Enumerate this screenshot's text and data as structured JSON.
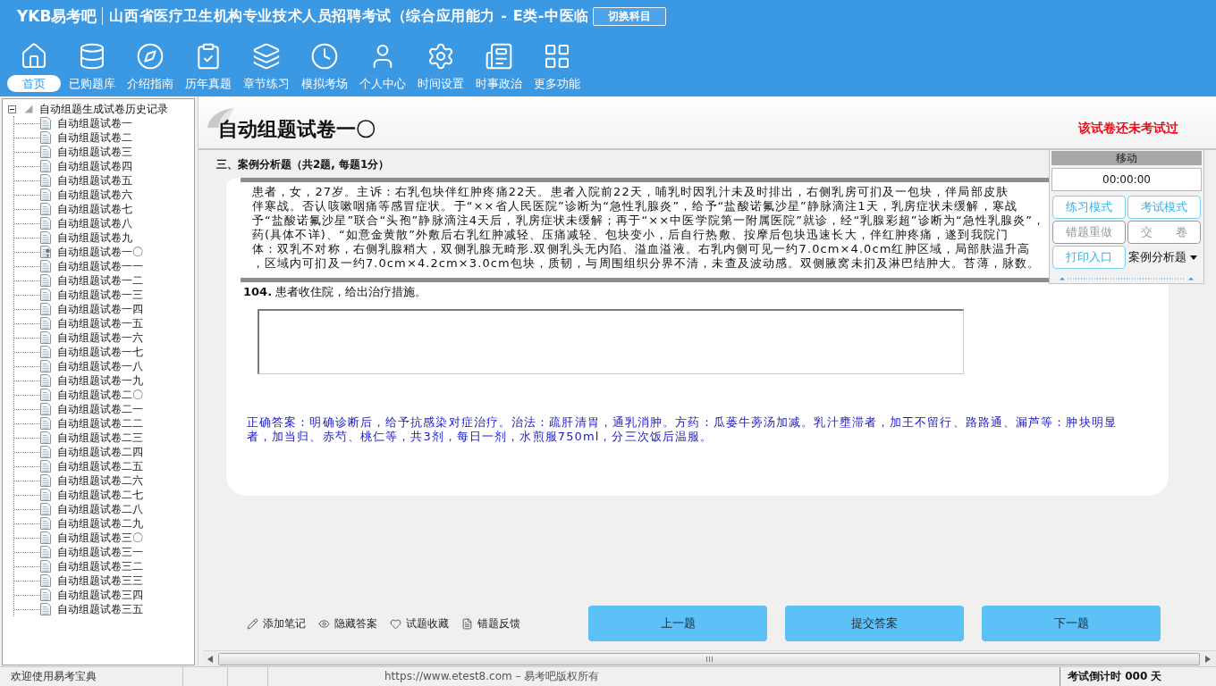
{
  "header": {
    "logo": "YKB易考吧",
    "title": "山西省医疗卫生机构专业技术人员招聘考试（综合应用能力 - E类-中医临",
    "switch_button": "切换科目"
  },
  "nav": [
    {
      "label": "首页",
      "selected": true
    },
    {
      "label": "已购题库",
      "selected": false
    },
    {
      "label": "介绍指南",
      "selected": false
    },
    {
      "label": "历年真题",
      "selected": false
    },
    {
      "label": "章节练习",
      "selected": false
    },
    {
      "label": "模拟考场",
      "selected": false
    },
    {
      "label": "个人中心",
      "selected": false
    },
    {
      "label": "时间设置",
      "selected": false
    },
    {
      "label": "时事政治",
      "selected": false
    },
    {
      "label": "更多功能",
      "selected": false
    }
  ],
  "tree": {
    "label": "自动组题生成试卷历史记录",
    "expanded": true,
    "children": [
      {
        "label": "自动组题试卷一",
        "selected": false
      },
      {
        "label": "自动组题试卷二",
        "selected": false
      },
      {
        "label": "自动组题试卷三",
        "selected": false
      },
      {
        "label": "自动组题试卷四",
        "selected": false
      },
      {
        "label": "自动组题试卷五",
        "selected": false
      },
      {
        "label": "自动组题试卷六",
        "selected": false
      },
      {
        "label": "自动组题试卷七",
        "selected": false
      },
      {
        "label": "自动组题试卷八",
        "selected": false
      },
      {
        "label": "自动组题试卷九",
        "selected": false
      },
      {
        "label": "自动组题试卷一〇",
        "selected": true
      },
      {
        "label": "自动组题试卷一一",
        "selected": false
      },
      {
        "label": "自动组题试卷一二",
        "selected": false
      },
      {
        "label": "自动组题试卷一三",
        "selected": false
      },
      {
        "label": "自动组题试卷一四",
        "selected": false
      },
      {
        "label": "自动组题试卷一五",
        "selected": false
      },
      {
        "label": "自动组题试卷一六",
        "selected": false
      },
      {
        "label": "自动组题试卷一七",
        "selected": false
      },
      {
        "label": "自动组题试卷一八",
        "selected": false
      },
      {
        "label": "自动组题试卷一九",
        "selected": false
      },
      {
        "label": "自动组题试卷二〇",
        "selected": false
      },
      {
        "label": "自动组题试卷二一",
        "selected": false
      },
      {
        "label": "自动组题试卷二二",
        "selected": false
      },
      {
        "label": "自动组题试卷二三",
        "selected": false
      },
      {
        "label": "自动组题试卷二四",
        "selected": false
      },
      {
        "label": "自动组题试卷二五",
        "selected": false
      },
      {
        "label": "自动组题试卷二六",
        "selected": false
      },
      {
        "label": "自动组题试卷二七",
        "selected": false
      },
      {
        "label": "自动组题试卷二八",
        "selected": false
      },
      {
        "label": "自动组题试卷二九",
        "selected": false
      },
      {
        "label": "自动组题试卷三〇",
        "selected": false
      },
      {
        "label": "自动组题试卷三一",
        "selected": false
      },
      {
        "label": "自动组题试卷三二",
        "selected": false
      },
      {
        "label": "自动组题试卷三三",
        "selected": false
      },
      {
        "label": "自动组题试卷三四",
        "selected": false
      },
      {
        "label": "自动组题试卷三五",
        "selected": false
      }
    ]
  },
  "paper": {
    "title": "自动组题试卷一〇",
    "status": "该试卷还未考试过"
  },
  "section": "三、案例分析题（共2题, 每题1分）",
  "case_lines": [
    "患者，女，27岁。主诉：右乳包块伴红肿疼痛22天。患者入院前22天，哺乳时因乳汁未及时排出，右侧乳房可扪及一包块，伴局部皮肤",
    "伴寒战。否认咳嗽咽痛等感冒症状。于“××省人民医院”诊断为“急性乳腺炎”，给予“盐酸诺氟沙星”静脉滴注1天，乳房症状未缓解，寒战",
    "予“盐酸诺氟沙星”联合“头孢”静脉滴注4天后，乳房症状未缓解；再于“××中医学院第一附属医院”就诊，经“乳腺彩超”诊断为“急性乳腺炎”，",
    "药(具体不详)、“如意金黄散”外敷后右乳红肿减轻、压痛减轻、包块变小，后自行热敷、按摩后包块迅速长大，伴红肿疼痛，遂到我院门",
    "体：双乳不对称，右侧乳腺稍大，双侧乳腺无畸形.双侧乳头无内陷、溢血溢液。右乳内侧可见一约7.0cm×4.0cm红肿区域，局部肤温升高",
    "，区域内可扪及一约7.0cm×4.2cm×3.0cm包块，质韧，与周围组织分界不清，未查及波动感。双侧腋窝未扪及淋巴结肿大。苔薄，脉数。"
  ],
  "question": {
    "text": "**104.** 患者收住院，给出治疗措施。",
    "answer": "正确答案：明确诊断后，给予抗感染对症治疗。治法：疏肝清胃，通乳消肿。方药：瓜蒌牛蒡汤加减。乳汁壅滞者，加王不留行、路路通、漏芦等：肿块明显者，加当归、赤芍、桃仁等，共3剂，每日一剂，水煎服750ml，分三次饭后温服。"
  },
  "panel": {
    "header": "移动",
    "timer": "00:00:00",
    "buttons": [
      {
        "label": "练习模式",
        "disabled": false
      },
      {
        "label": "考试模式",
        "disabled": false
      },
      {
        "label": "错题重做",
        "disabled": true
      },
      {
        "label": "交　　卷",
        "disabled": true
      },
      {
        "label": "打印入口",
        "disabled": false
      }
    ],
    "type_select": "案例分析题"
  },
  "tools": [
    {
      "label": "添加笔记"
    },
    {
      "label": "隐藏答案"
    },
    {
      "label": "试题收藏"
    },
    {
      "label": "错题反馈"
    }
  ],
  "buttons": [
    {
      "label": "上一题"
    },
    {
      "label": "提交答案"
    },
    {
      "label": "下一题"
    }
  ],
  "status_bar": {
    "welcome": "欢迎使用易考宝典",
    "copyright": "https://www.etest8.com – 易考吧版权所有",
    "countdown": "考试倒计时 000 天"
  }
}
